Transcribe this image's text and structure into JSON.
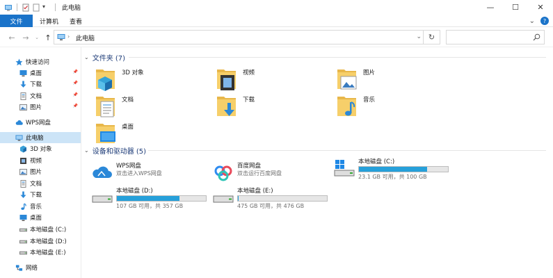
{
  "window": {
    "title": "此电脑",
    "controls": {
      "minimize": "—",
      "maximize": "☐",
      "close": "✕"
    }
  },
  "ribbon": {
    "tabs": [
      "文件",
      "计算机",
      "查看"
    ],
    "expand": "⌄",
    "help": "?"
  },
  "address": {
    "crumb": "此电脑",
    "dropdown": "⌄",
    "refresh": "↻",
    "search_placeholder": ""
  },
  "sidebar": {
    "items": [
      {
        "label": "快速访问",
        "icon": "star-icon",
        "pinned": false,
        "indent": 1
      },
      {
        "label": "桌面",
        "icon": "desktop-icon",
        "pinned": true,
        "indent": 2
      },
      {
        "label": "下载",
        "icon": "download-icon",
        "pinned": true,
        "indent": 2
      },
      {
        "label": "文档",
        "icon": "document-icon",
        "pinned": true,
        "indent": 2
      },
      {
        "label": "图片",
        "icon": "picture-icon",
        "pinned": true,
        "indent": 2
      },
      {
        "label": "WPS网盘",
        "icon": "cloud-icon",
        "pinned": false,
        "indent": 1
      },
      {
        "label": "此电脑",
        "icon": "computer-icon",
        "pinned": false,
        "indent": 1,
        "selected": true
      },
      {
        "label": "3D 对象",
        "icon": "cube-icon",
        "pinned": false,
        "indent": 2
      },
      {
        "label": "视频",
        "icon": "video-icon",
        "pinned": false,
        "indent": 2
      },
      {
        "label": "图片",
        "icon": "picture-icon",
        "pinned": false,
        "indent": 2
      },
      {
        "label": "文档",
        "icon": "document-icon",
        "pinned": false,
        "indent": 2
      },
      {
        "label": "下载",
        "icon": "download-icon",
        "pinned": false,
        "indent": 2
      },
      {
        "label": "音乐",
        "icon": "music-icon",
        "pinned": false,
        "indent": 2
      },
      {
        "label": "桌面",
        "icon": "desktop-icon",
        "pinned": false,
        "indent": 2
      },
      {
        "label": "本地磁盘 (C:)",
        "icon": "drive-icon",
        "pinned": false,
        "indent": 2
      },
      {
        "label": "本地磁盘 (D:)",
        "icon": "drive-icon",
        "pinned": false,
        "indent": 2
      },
      {
        "label": "本地磁盘 (E:)",
        "icon": "drive-icon",
        "pinned": false,
        "indent": 2
      },
      {
        "label": "网络",
        "icon": "network-icon",
        "pinned": false,
        "indent": 1
      }
    ]
  },
  "folders_section": {
    "title": "文件夹 (7)",
    "items": [
      {
        "label": "3D 对象",
        "overlay": "cube"
      },
      {
        "label": "视频",
        "overlay": "film"
      },
      {
        "label": "图片",
        "overlay": "picture"
      },
      {
        "label": "文档",
        "overlay": "document"
      },
      {
        "label": "下载",
        "overlay": "download"
      },
      {
        "label": "音乐",
        "overlay": "music"
      },
      {
        "label": "桌面",
        "overlay": "desktop"
      }
    ]
  },
  "devices_section": {
    "title": "设备和驱动器 (5)",
    "items": [
      {
        "name": "WPS网盘",
        "sub": "双击进入WPS网盘",
        "type": "cloud"
      },
      {
        "name": "百度网盘",
        "sub": "双击运行百度网盘",
        "type": "baidu"
      },
      {
        "name": "本地磁盘 (C:)",
        "sub": "23.1 GB 可用，共 100 GB",
        "type": "windrive",
        "used_fraction": 0.769
      },
      {
        "name": "本地磁盘 (D:)",
        "sub": "107 GB 可用，共 357 GB",
        "type": "drive",
        "used_fraction": 0.7
      },
      {
        "name": "本地磁盘 (E:)",
        "sub": "475 GB 可用，共 476 GB",
        "type": "drive",
        "used_fraction": 0.002
      }
    ]
  },
  "colors": {
    "accent": "#1a73c9",
    "selected": "#cce4f7",
    "bar_fill": "#26a0da",
    "section_title": "#1e3c78"
  }
}
